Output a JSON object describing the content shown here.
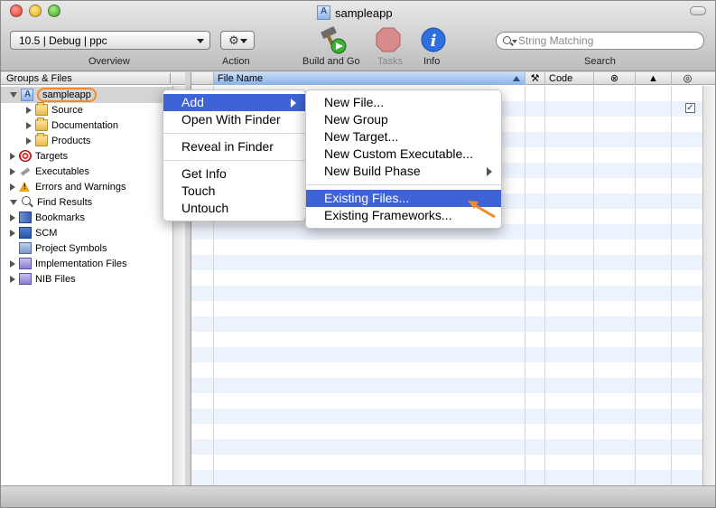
{
  "window": {
    "title": "sampleapp"
  },
  "toolbar": {
    "overview_value": "10.5 | Debug | ppc",
    "overview_label": "Overview",
    "action_label": "Action",
    "build_label": "Build and Go",
    "tasks_label": "Tasks",
    "info_label": "Info",
    "search_placeholder": "String Matching",
    "search_label": "Search"
  },
  "sidebar": {
    "header": "Groups & Files",
    "items": [
      {
        "label": "sampleapp",
        "icon": "project-icon",
        "disclosure": "open",
        "indent": 0
      },
      {
        "label": "Source",
        "icon": "folder-icon",
        "disclosure": "closed",
        "indent": 1
      },
      {
        "label": "Documentation",
        "icon": "folder-icon",
        "disclosure": "closed",
        "indent": 1
      },
      {
        "label": "Products",
        "icon": "folder-icon",
        "disclosure": "closed",
        "indent": 1
      },
      {
        "label": "Targets",
        "icon": "target-icon",
        "disclosure": "closed",
        "indent": 0
      },
      {
        "label": "Executables",
        "icon": "executable-icon",
        "disclosure": "closed",
        "indent": 0
      },
      {
        "label": "Errors and Warnings",
        "icon": "warning-icon",
        "disclosure": "closed",
        "indent": 0
      },
      {
        "label": "Find Results",
        "icon": "magnifier-icon",
        "disclosure": "open",
        "indent": 0
      },
      {
        "label": "Bookmarks",
        "icon": "bookmark-icon",
        "disclosure": "closed",
        "indent": 0
      },
      {
        "label": "SCM",
        "icon": "scm-icon",
        "disclosure": "closed",
        "indent": 0
      },
      {
        "label": "Project Symbols",
        "icon": "symbols-icon",
        "disclosure": "none",
        "indent": 0
      },
      {
        "label": "Implementation Files",
        "icon": "implementation-icon",
        "disclosure": "closed",
        "indent": 0
      },
      {
        "label": "NIB Files",
        "icon": "nib-icon",
        "disclosure": "closed",
        "indent": 0
      }
    ]
  },
  "table": {
    "columns": [
      "File Name",
      "Code"
    ],
    "column_icons": [
      "hammer-icon",
      "error-icon",
      "warning-icon",
      "target-membership-icon"
    ]
  },
  "context_menu": {
    "items": [
      "Add",
      "Open With Finder",
      "Reveal in Finder",
      "Get Info",
      "Touch",
      "Untouch"
    ],
    "highlighted": "Add"
  },
  "add_submenu": {
    "items": [
      "New File...",
      "New Group",
      "New Target...",
      "New Custom Executable...",
      "New Build Phase",
      "Existing Files...",
      "Existing Frameworks..."
    ],
    "highlighted": "Existing Files..."
  },
  "colors": {
    "highlight": "#3d63d6",
    "annotation": "#f08a2b",
    "row_stripe": "#edf3fd"
  }
}
